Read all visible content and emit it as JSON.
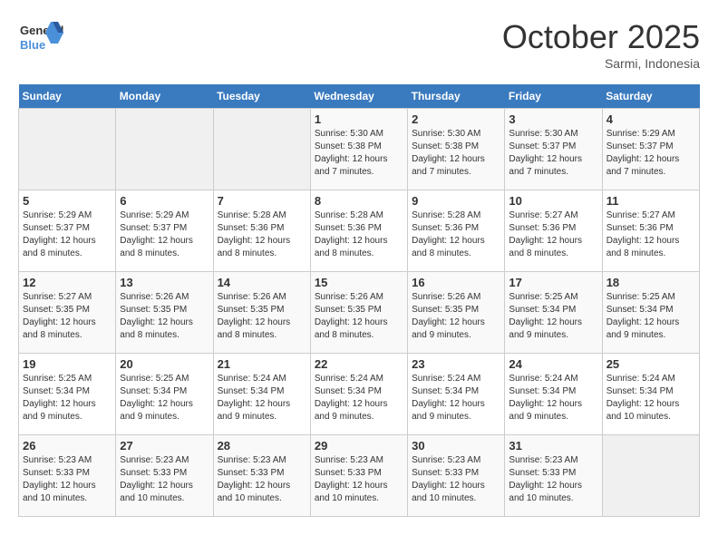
{
  "logo": {
    "line1": "General",
    "line2": "Blue"
  },
  "title": "October 2025",
  "subtitle": "Sarmi, Indonesia",
  "days_of_week": [
    "Sunday",
    "Monday",
    "Tuesday",
    "Wednesday",
    "Thursday",
    "Friday",
    "Saturday"
  ],
  "weeks": [
    [
      {
        "day": "",
        "detail": ""
      },
      {
        "day": "",
        "detail": ""
      },
      {
        "day": "",
        "detail": ""
      },
      {
        "day": "1",
        "detail": "Sunrise: 5:30 AM\nSunset: 5:38 PM\nDaylight: 12 hours\nand 7 minutes."
      },
      {
        "day": "2",
        "detail": "Sunrise: 5:30 AM\nSunset: 5:38 PM\nDaylight: 12 hours\nand 7 minutes."
      },
      {
        "day": "3",
        "detail": "Sunrise: 5:30 AM\nSunset: 5:37 PM\nDaylight: 12 hours\nand 7 minutes."
      },
      {
        "day": "4",
        "detail": "Sunrise: 5:29 AM\nSunset: 5:37 PM\nDaylight: 12 hours\nand 7 minutes."
      }
    ],
    [
      {
        "day": "5",
        "detail": "Sunrise: 5:29 AM\nSunset: 5:37 PM\nDaylight: 12 hours\nand 8 minutes."
      },
      {
        "day": "6",
        "detail": "Sunrise: 5:29 AM\nSunset: 5:37 PM\nDaylight: 12 hours\nand 8 minutes."
      },
      {
        "day": "7",
        "detail": "Sunrise: 5:28 AM\nSunset: 5:36 PM\nDaylight: 12 hours\nand 8 minutes."
      },
      {
        "day": "8",
        "detail": "Sunrise: 5:28 AM\nSunset: 5:36 PM\nDaylight: 12 hours\nand 8 minutes."
      },
      {
        "day": "9",
        "detail": "Sunrise: 5:28 AM\nSunset: 5:36 PM\nDaylight: 12 hours\nand 8 minutes."
      },
      {
        "day": "10",
        "detail": "Sunrise: 5:27 AM\nSunset: 5:36 PM\nDaylight: 12 hours\nand 8 minutes."
      },
      {
        "day": "11",
        "detail": "Sunrise: 5:27 AM\nSunset: 5:36 PM\nDaylight: 12 hours\nand 8 minutes."
      }
    ],
    [
      {
        "day": "12",
        "detail": "Sunrise: 5:27 AM\nSunset: 5:35 PM\nDaylight: 12 hours\nand 8 minutes."
      },
      {
        "day": "13",
        "detail": "Sunrise: 5:26 AM\nSunset: 5:35 PM\nDaylight: 12 hours\nand 8 minutes."
      },
      {
        "day": "14",
        "detail": "Sunrise: 5:26 AM\nSunset: 5:35 PM\nDaylight: 12 hours\nand 8 minutes."
      },
      {
        "day": "15",
        "detail": "Sunrise: 5:26 AM\nSunset: 5:35 PM\nDaylight: 12 hours\nand 8 minutes."
      },
      {
        "day": "16",
        "detail": "Sunrise: 5:26 AM\nSunset: 5:35 PM\nDaylight: 12 hours\nand 9 minutes."
      },
      {
        "day": "17",
        "detail": "Sunrise: 5:25 AM\nSunset: 5:34 PM\nDaylight: 12 hours\nand 9 minutes."
      },
      {
        "day": "18",
        "detail": "Sunrise: 5:25 AM\nSunset: 5:34 PM\nDaylight: 12 hours\nand 9 minutes."
      }
    ],
    [
      {
        "day": "19",
        "detail": "Sunrise: 5:25 AM\nSunset: 5:34 PM\nDaylight: 12 hours\nand 9 minutes."
      },
      {
        "day": "20",
        "detail": "Sunrise: 5:25 AM\nSunset: 5:34 PM\nDaylight: 12 hours\nand 9 minutes."
      },
      {
        "day": "21",
        "detail": "Sunrise: 5:24 AM\nSunset: 5:34 PM\nDaylight: 12 hours\nand 9 minutes."
      },
      {
        "day": "22",
        "detail": "Sunrise: 5:24 AM\nSunset: 5:34 PM\nDaylight: 12 hours\nand 9 minutes."
      },
      {
        "day": "23",
        "detail": "Sunrise: 5:24 AM\nSunset: 5:34 PM\nDaylight: 12 hours\nand 9 minutes."
      },
      {
        "day": "24",
        "detail": "Sunrise: 5:24 AM\nSunset: 5:34 PM\nDaylight: 12 hours\nand 9 minutes."
      },
      {
        "day": "25",
        "detail": "Sunrise: 5:24 AM\nSunset: 5:34 PM\nDaylight: 12 hours\nand 10 minutes."
      }
    ],
    [
      {
        "day": "26",
        "detail": "Sunrise: 5:23 AM\nSunset: 5:33 PM\nDaylight: 12 hours\nand 10 minutes."
      },
      {
        "day": "27",
        "detail": "Sunrise: 5:23 AM\nSunset: 5:33 PM\nDaylight: 12 hours\nand 10 minutes."
      },
      {
        "day": "28",
        "detail": "Sunrise: 5:23 AM\nSunset: 5:33 PM\nDaylight: 12 hours\nand 10 minutes."
      },
      {
        "day": "29",
        "detail": "Sunrise: 5:23 AM\nSunset: 5:33 PM\nDaylight: 12 hours\nand 10 minutes."
      },
      {
        "day": "30",
        "detail": "Sunrise: 5:23 AM\nSunset: 5:33 PM\nDaylight: 12 hours\nand 10 minutes."
      },
      {
        "day": "31",
        "detail": "Sunrise: 5:23 AM\nSunset: 5:33 PM\nDaylight: 12 hours\nand 10 minutes."
      },
      {
        "day": "",
        "detail": ""
      }
    ]
  ]
}
